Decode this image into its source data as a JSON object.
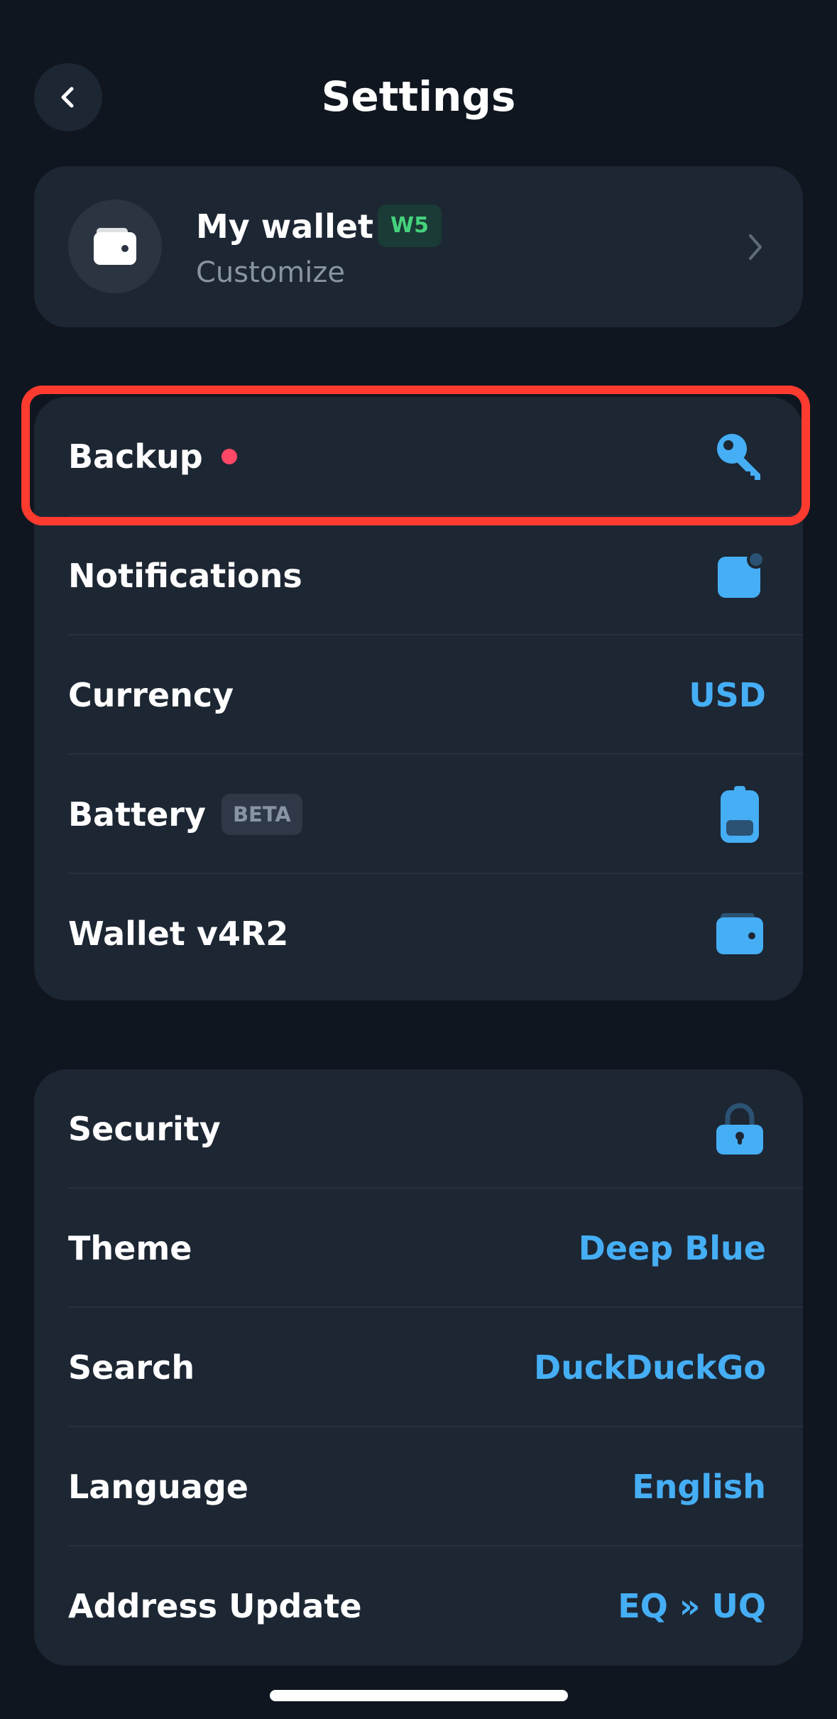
{
  "header": {
    "title": "Settings"
  },
  "wallet": {
    "name": "My wallet",
    "badge": "W5",
    "subtitle": "Customize"
  },
  "group1": {
    "backup_label": "Backup",
    "notifications_label": "Notifications",
    "currency_label": "Currency",
    "currency_value": "USD",
    "battery_label": "Battery",
    "battery_badge": "BETA",
    "wallet_version_label": "Wallet v4R2"
  },
  "group2": {
    "security_label": "Security",
    "theme_label": "Theme",
    "theme_value": "Deep Blue",
    "search_label": "Search",
    "search_value": "DuckDuckGo",
    "language_label": "Language",
    "language_value": "English",
    "address_label": "Address Update",
    "address_value": "EQ » UQ"
  },
  "colors": {
    "background": "#10161f",
    "card": "#1d2633",
    "accent": "#45aef5",
    "badge_green": "#45d27c",
    "notification_dot": "#ff4766",
    "highlight": "#ff3b30"
  },
  "icons": [
    "chevron-left-icon",
    "wallet-icon",
    "chevron-right-icon",
    "key-icon",
    "notification-icon",
    "battery-icon",
    "wallet-icon",
    "lock-icon"
  ]
}
